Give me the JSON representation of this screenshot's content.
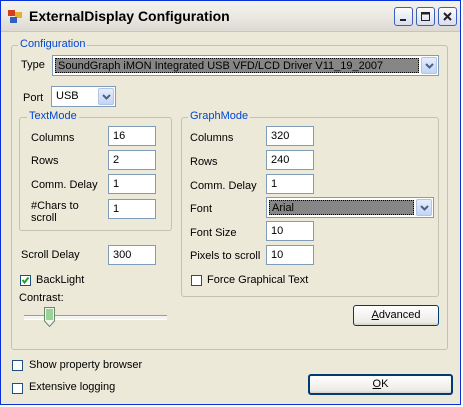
{
  "window": {
    "title": "ExternalDisplay Configuration"
  },
  "configuration": {
    "group_label": "Configuration",
    "type_label": "Type",
    "type_value": "SoundGraph iMON Integrated USB VFD/LCD Driver V11_19_2007",
    "port_label": "Port",
    "port_value": "USB"
  },
  "textmode": {
    "group_label": "TextMode",
    "columns_label": "Columns",
    "columns_value": "16",
    "rows_label": "Rows",
    "rows_value": "2",
    "comm_delay_label": "Comm. Delay",
    "comm_delay_value": "1",
    "chars_scroll_label_1": "#Chars to",
    "chars_scroll_label_2": "scroll",
    "chars_scroll_value": "1"
  },
  "graphmode": {
    "group_label": "GraphMode",
    "columns_label": "Columns",
    "columns_value": "320",
    "rows_label": "Rows",
    "rows_value": "240",
    "comm_delay_label": "Comm. Delay",
    "comm_delay_value": "1",
    "font_label": "Font",
    "font_value": "Arial",
    "font_size_label": "Font Size",
    "font_size_value": "10",
    "pixels_scroll_label": "Pixels to scroll",
    "pixels_scroll_value": "10",
    "force_graphical_label": "Force Graphical Text",
    "force_graphical_checked": false
  },
  "misc": {
    "scroll_delay_label": "Scroll Delay",
    "scroll_delay_value": "300",
    "backlight_label": "BackLight",
    "backlight_checked": true,
    "contrast_label": "Contrast:",
    "contrast_level": 0.15,
    "advanced_label_underlined": "A",
    "advanced_label_rest": "dvanced",
    "show_property_browser_label": "Show property browser",
    "show_property_browser_checked": false,
    "extensive_logging_label": "Extensive logging",
    "extensive_logging_checked": false,
    "ok_label_underlined": "O",
    "ok_label_rest": "K"
  },
  "colors": {
    "group_label": "#0046d5",
    "window_bg": "#ece9d8",
    "title_bar": "#ebe9e1"
  }
}
